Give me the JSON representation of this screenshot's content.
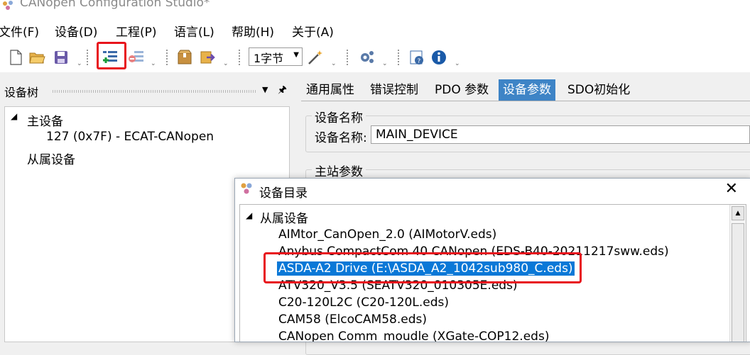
{
  "window": {
    "title": "CANopen Configuration Studio*"
  },
  "menu": [
    "文件(F)",
    "设备(D)",
    "工程(P)",
    "语言(L)",
    "帮助(H)",
    "关于(A)"
  ],
  "toolbar": {
    "font_size_value": "1字节",
    "buttons": [
      "new-file-icon",
      "open-folder-icon",
      "save-icon",
      "add-device-icon",
      "remove-device-icon",
      "package-icon",
      "export-icon",
      "wand-icon",
      "settings-icon",
      "help-icon",
      "info-icon"
    ]
  },
  "left_pane": {
    "title": "设备树",
    "tree": {
      "master_label": "主设备",
      "master_node": "127 (0x7F)  -  ECAT-CANopen",
      "slave_label": "从属设备"
    }
  },
  "tabs": [
    "通用属性",
    "错误控制",
    "PDO 参数",
    "设备参数",
    "SDO初始化"
  ],
  "active_tab": "设备参数",
  "device_params": {
    "group_name_title": "设备名称",
    "name_label": "设备名称:",
    "name_value": "MAIN_DEVICE",
    "group_master_title": "主站参数"
  },
  "dialog": {
    "title": "设备目录",
    "root_label": "从属设备",
    "items": [
      "AIMtor_CanOpen_2.0 (AIMotorV.eds)",
      "Anybus CompactCom 40 CANopen (EDS-B40-20211217sww.eds)",
      "ASDA-A2 Drive (E:\\ASDA_A2_1042sub980_C.eds)",
      "ATV320_V3.5 (SEATV320_010305E.eds)",
      "C20-120L2C (C20-120L.eds)",
      "CAM58 (ElcoCAM58.eds)",
      "CANopen Comm_moudle (XGate-COP12.eds)"
    ],
    "selected_index": 2
  },
  "colors": {
    "accent": "#3e84c6",
    "selection": "#0a78d7",
    "highlight": "#e8141c"
  }
}
